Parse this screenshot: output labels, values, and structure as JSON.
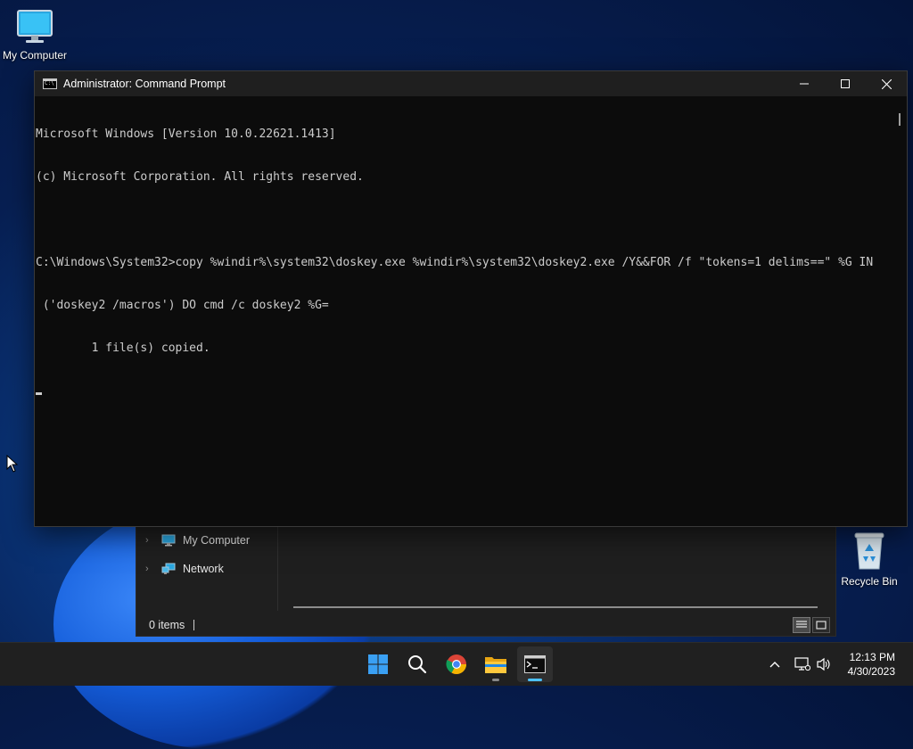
{
  "desktop": {
    "icons": [
      {
        "label": "My Computer"
      },
      {
        "label": "Recycle Bin"
      }
    ]
  },
  "explorer": {
    "nav_items": [
      {
        "label": "My Computer"
      },
      {
        "label": "Network"
      }
    ],
    "status": {
      "items": "0 items"
    }
  },
  "cmd": {
    "title": "Administrator: Command Prompt",
    "lines": [
      "Microsoft Windows [Version 10.0.22621.1413]",
      "(c) Microsoft Corporation. All rights reserved.",
      "",
      "C:\\Windows\\System32>copy %windir%\\system32\\doskey.exe %windir%\\system32\\doskey2.exe /Y&&FOR /f \"tokens=1 delims==\" %G IN",
      " ('doskey2 /macros') DO cmd /c doskey2 %G=",
      "        1 file(s) copied."
    ]
  },
  "taskbar": {
    "pinned": [
      {
        "icon": "start-icon"
      },
      {
        "icon": "search-icon"
      },
      {
        "icon": "chrome-icon"
      },
      {
        "icon": "file-explorer-icon"
      },
      {
        "icon": "terminal-icon"
      }
    ],
    "time": "12:13 PM",
    "date": "4/30/2023"
  },
  "colors": {
    "accent": "#4cc2ff",
    "console_bg": "#0c0c0c",
    "console_text": "#cccccc"
  }
}
